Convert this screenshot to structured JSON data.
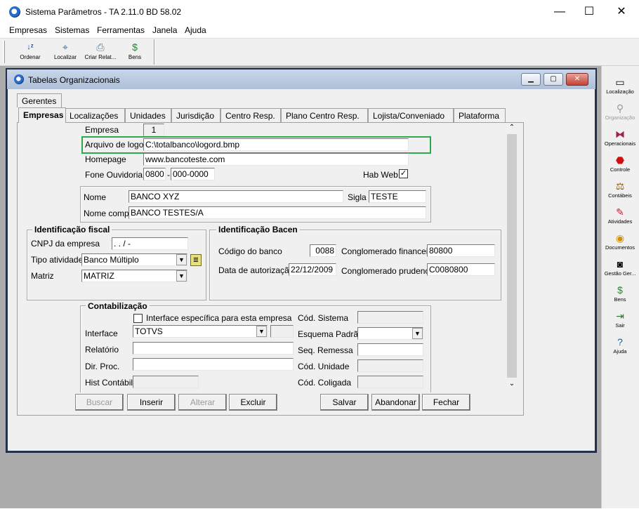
{
  "window": {
    "title": "Sistema Parâmetros  -  TA 2.11.0 BD 58.02",
    "minimize": "—",
    "maximize": "☐",
    "close": "✕"
  },
  "menu": [
    "Empresas",
    "Sistemas",
    "Ferramentas",
    "Janela",
    "Ajuda"
  ],
  "toolbar": [
    {
      "label": "Ordenar",
      "icon": "sort-az-icon"
    },
    {
      "label": "Localizar",
      "icon": "find-icon"
    },
    {
      "label": "Criar Relat...",
      "icon": "printer-icon"
    },
    {
      "label": "Bens",
      "icon": "money-bag-icon"
    }
  ],
  "right_panel": [
    {
      "label": "Localização",
      "icon": "location-icon"
    },
    {
      "label": "Organização",
      "icon": "organization-icon"
    },
    {
      "label": "Operacionais",
      "icon": "operations-icon"
    },
    {
      "label": "Controle",
      "icon": "stop-control-icon"
    },
    {
      "label": "Contábeis",
      "icon": "scales-icon"
    },
    {
      "label": "Atividades",
      "icon": "activities-icon"
    },
    {
      "label": "Documentos",
      "icon": "documents-icon"
    },
    {
      "label": "Gestão Ger...",
      "icon": "management-icon"
    },
    {
      "label": "Bens",
      "icon": "money-bag-icon"
    },
    {
      "label": "Sair",
      "icon": "exit-icon"
    },
    {
      "label": "Ajuda",
      "icon": "help-icon"
    }
  ],
  "inner": {
    "title": "Tabelas Organizacionais",
    "tabs_row1": [
      "Gerentes"
    ],
    "tabs_row2": [
      "Empresas",
      "Localizações",
      "Unidades",
      "Jurisdição",
      "Centro Resp.",
      "Plano Centro Resp.",
      "Lojista/Conveniado",
      "Plataforma"
    ],
    "active_tab": "Empresas"
  },
  "form": {
    "empresa_label": "Empresa",
    "empresa_value": "1",
    "arquivo_logo_label": "Arquivo de logo",
    "arquivo_logo_value": "C:\\totalbanco\\logord.bmp",
    "homepage_label": "Homepage",
    "homepage_value": "www.bancoteste.com",
    "fone_label": "Fone Ouvidoria",
    "fone_ddd": "0800",
    "fone_sep": "-",
    "fone_num": "000-0000",
    "habweb_label": "Hab Web",
    "habweb_checked": "✓",
    "nome_label": "Nome",
    "nome_value": "BANCO XYZ",
    "sigla_label": "Sigla",
    "sigla_value": "TESTE",
    "nome_compl_label": "Nome compl.",
    "nome_compl_value": "BANCO TESTES/A",
    "fiscal_title": "Identificação fiscal",
    "cnpj_label": "CNPJ da empresa",
    "cnpj_value": " .   .    /    -",
    "tipo_atividade_label": "Tipo atividade",
    "tipo_atividade_value": "Banco Múltiplo",
    "matriz_label": "Matriz",
    "matriz_value": "MATRIZ",
    "bacen_title": "Identificação Bacen",
    "codigo_banco_label": "Código do banco",
    "codigo_banco_value": "0088",
    "data_autorizacao_label": "Data de autorização",
    "data_autorizacao_value": "22/12/2009",
    "conglomerado_fin_label": "Conglomerado financeiro",
    "conglomerado_fin_value": "80800",
    "conglomerado_prud_label": "Conglomerado prudencial",
    "conglomerado_prud_value": "C0080800",
    "contab_title": "Contabilização",
    "interface_especifica_label": "Interface específica para esta empresa",
    "interface_label": "Interface",
    "interface_value": "TOTVS",
    "relatorio_label": "Relatório",
    "dir_proc_label": "Dir. Proc.",
    "hist_contabil_label": "Hist Contábil",
    "cod_sistema_label": "Cód. Sistema",
    "esquema_padrao_label": "Esquema Padrão",
    "seq_remessa_label": "Seq. Remessa",
    "cod_unidade_label": "Cód. Unidade",
    "cod_coligada_label": "Cód. Coligada"
  },
  "buttons": {
    "buscar": "Buscar",
    "inserir": "Inserir",
    "alterar": "Alterar",
    "excluir": "Excluir",
    "salvar": "Salvar",
    "abandonar": "Abandonar",
    "fechar": "Fechar"
  }
}
